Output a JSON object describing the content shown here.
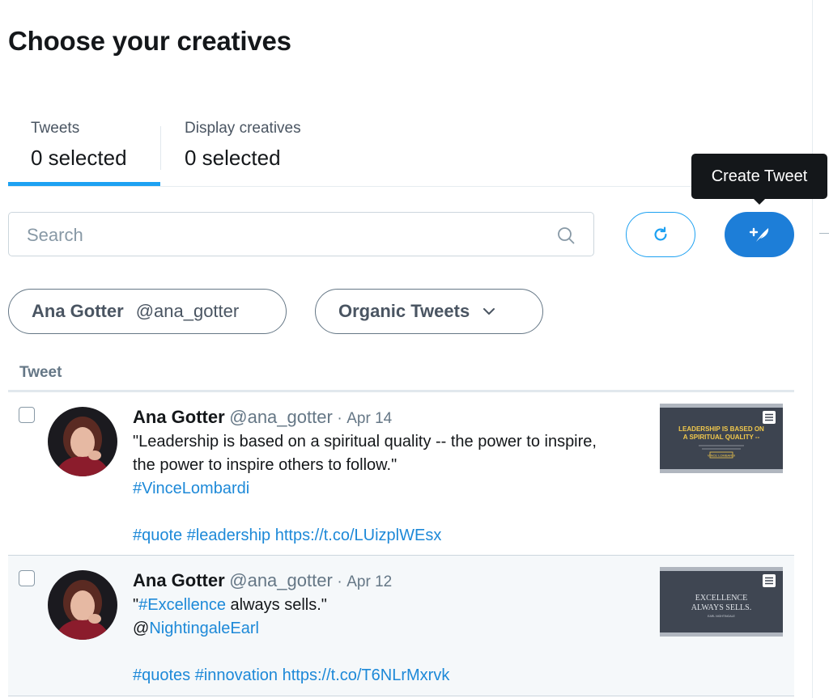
{
  "page": {
    "title": "Choose your creatives"
  },
  "tabs": [
    {
      "label": "Tweets",
      "count": "0 selected",
      "active": true
    },
    {
      "label": "Display creatives",
      "count": "0 selected",
      "active": false
    }
  ],
  "toolbar": {
    "search_placeholder": "Search",
    "search_icon": "search-icon",
    "refresh_icon": "refresh-icon",
    "create_icon": "compose-feather-icon",
    "create_tooltip": "Create Tweet"
  },
  "filters": {
    "account_name": "Ana Gotter",
    "account_handle": "@ana_gotter",
    "tweet_type": "Organic Tweets"
  },
  "table": {
    "column_header": "Tweet"
  },
  "tweets": [
    {
      "name": "Ana Gotter",
      "handle": "@ana_gotter",
      "sep": "·",
      "date": "Apr 14",
      "line1": "\"Leadership is based on a spiritual quality -- the power to inspire,",
      "line2": "the power to inspire others to follow.\"",
      "tag1": "#VinceLombardi",
      "tag2": "#quote",
      "tag3": "#leadership",
      "url": "https://t.co/LUizplWEsx",
      "thumb_line1": "LEADERSHIP IS BASED ON",
      "thumb_line2": "A SPIRITUAL QUALITY --",
      "thumb_badge": "VINCE LOMBARDI"
    },
    {
      "name": "Ana Gotter",
      "handle": "@ana_gotter",
      "sep": "·",
      "date": "Apr 12",
      "quote_open": "\"",
      "tag1": "#Excellence",
      "text_after": " always sells.\"",
      "at": "@",
      "mention": "NightingaleEarl",
      "tag2": "#quotes",
      "tag3": "#innovation",
      "url": "https://t.co/T6NLrMxrvk",
      "thumb_line1": "EXCELLENCE",
      "thumb_line2": "ALWAYS SELLS.",
      "thumb_badge": "EARL NIGHTINGALE"
    }
  ],
  "colors": {
    "accent": "#1da1f2",
    "create_button": "#1d7ed8",
    "link": "#1d89d8",
    "selected_row_bg": "#f5f8fa"
  }
}
